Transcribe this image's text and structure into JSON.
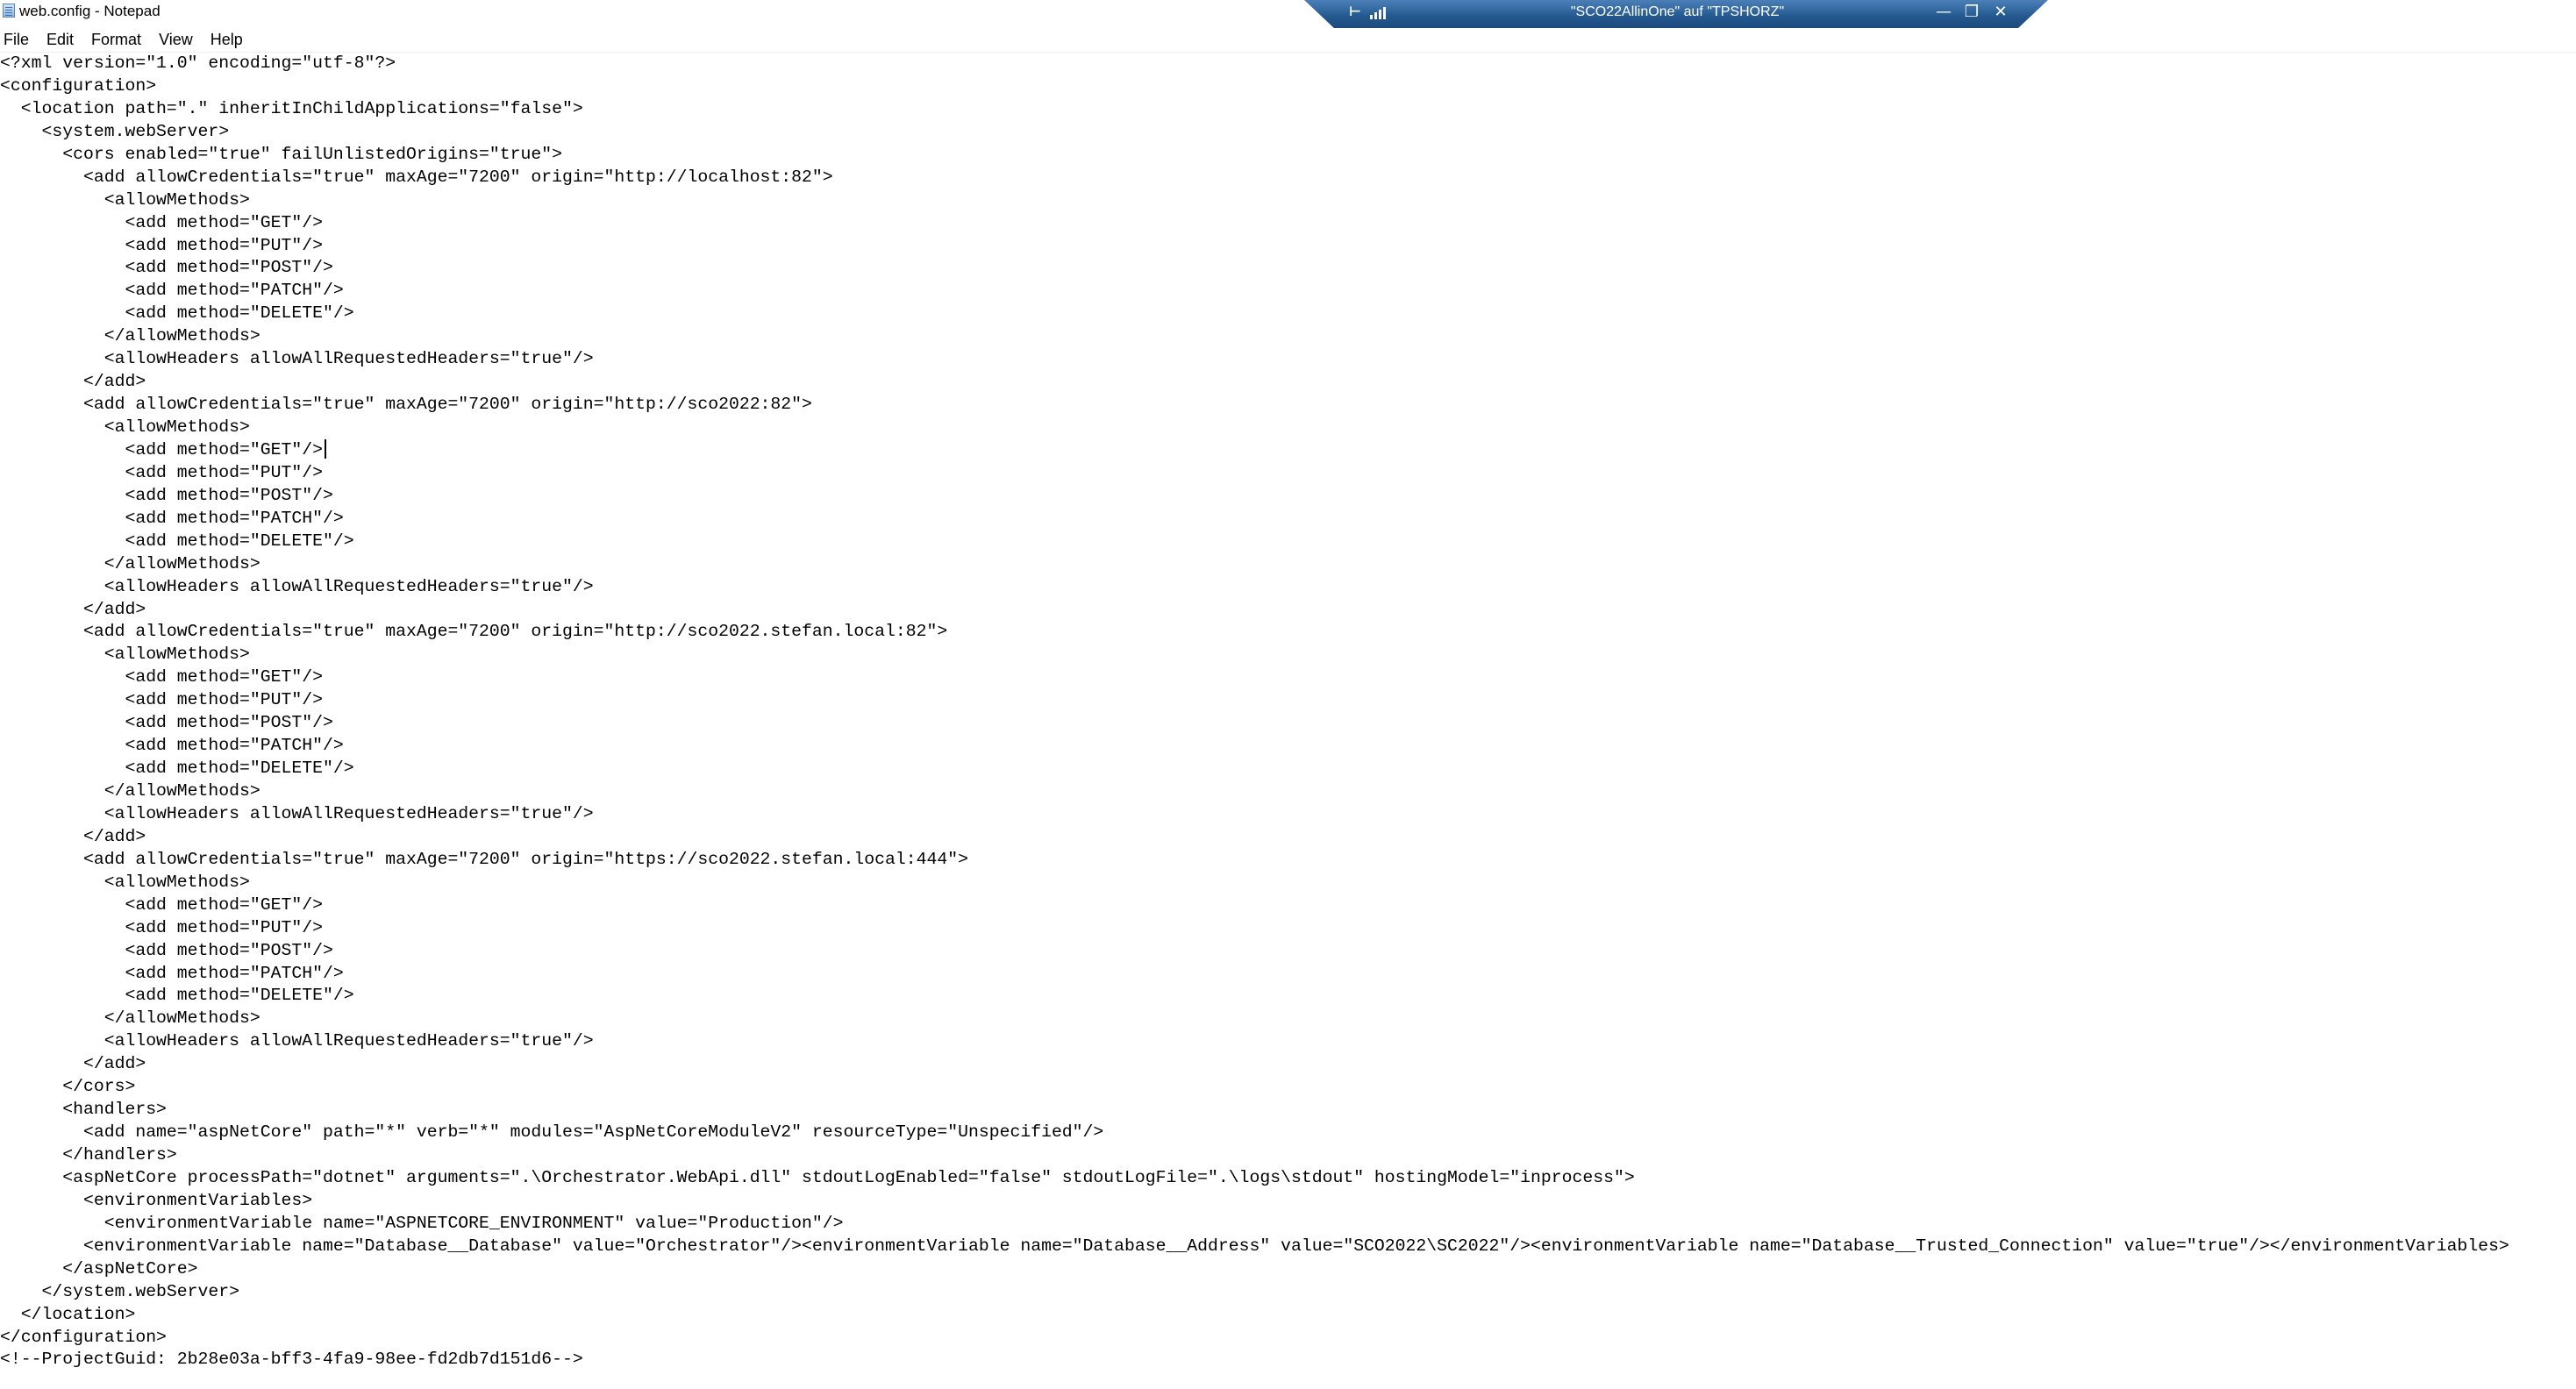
{
  "window": {
    "title": "web.config - Notepad"
  },
  "remote_bar": {
    "title": "\"SCO22AllinOne\" auf \"TPSHORZ\"",
    "minimize": "—",
    "restore": "❐",
    "close": "✕"
  },
  "menu": {
    "items": [
      {
        "label": "File"
      },
      {
        "label": "Edit"
      },
      {
        "label": "Format"
      },
      {
        "label": "View"
      },
      {
        "label": "Help"
      }
    ]
  },
  "editor": {
    "lines": [
      "<?xml version=\"1.0\" encoding=\"utf-8\"?>",
      "<configuration>",
      "  <location path=\".\" inheritInChildApplications=\"false\">",
      "    <system.webServer>",
      "      <cors enabled=\"true\" failUnlistedOrigins=\"true\">",
      "        <add allowCredentials=\"true\" maxAge=\"7200\" origin=\"http://localhost:82\">",
      "          <allowMethods>",
      "            <add method=\"GET\"/>",
      "            <add method=\"PUT\"/>",
      "            <add method=\"POST\"/>",
      "            <add method=\"PATCH\"/>",
      "            <add method=\"DELETE\"/>",
      "          </allowMethods>",
      "          <allowHeaders allowAllRequestedHeaders=\"true\"/>",
      "        </add>",
      "        <add allowCredentials=\"true\" maxAge=\"7200\" origin=\"http://sco2022:82\">",
      "          <allowMethods>",
      "            <add method=\"GET\"/>",
      "            <add method=\"PUT\"/>",
      "            <add method=\"POST\"/>",
      "            <add method=\"PATCH\"/>",
      "            <add method=\"DELETE\"/>",
      "          </allowMethods>",
      "          <allowHeaders allowAllRequestedHeaders=\"true\"/>",
      "        </add>",
      "        <add allowCredentials=\"true\" maxAge=\"7200\" origin=\"http://sco2022.stefan.local:82\">",
      "          <allowMethods>",
      "            <add method=\"GET\"/>",
      "            <add method=\"PUT\"/>",
      "            <add method=\"POST\"/>",
      "            <add method=\"PATCH\"/>",
      "            <add method=\"DELETE\"/>",
      "          </allowMethods>",
      "          <allowHeaders allowAllRequestedHeaders=\"true\"/>",
      "        </add>",
      "        <add allowCredentials=\"true\" maxAge=\"7200\" origin=\"https://sco2022.stefan.local:444\">",
      "          <allowMethods>",
      "            <add method=\"GET\"/>",
      "            <add method=\"PUT\"/>",
      "            <add method=\"POST\"/>",
      "            <add method=\"PATCH\"/>",
      "            <add method=\"DELETE\"/>",
      "          </allowMethods>",
      "          <allowHeaders allowAllRequestedHeaders=\"true\"/>",
      "        </add>",
      "      </cors>",
      "      <handlers>",
      "        <add name=\"aspNetCore\" path=\"*\" verb=\"*\" modules=\"AspNetCoreModuleV2\" resourceType=\"Unspecified\"/>",
      "      </handlers>",
      "      <aspNetCore processPath=\"dotnet\" arguments=\".\\Orchestrator.WebApi.dll\" stdoutLogEnabled=\"false\" stdoutLogFile=\".\\logs\\stdout\" hostingModel=\"inprocess\">",
      "        <environmentVariables>",
      "          <environmentVariable name=\"ASPNETCORE_ENVIRONMENT\" value=\"Production\"/>",
      "        <environmentVariable name=\"Database__Database\" value=\"Orchestrator\"/><environmentVariable name=\"Database__Address\" value=\"SCO2022\\SC2022\"/><environmentVariable name=\"Database__Trusted_Connection\" value=\"true\"/></environmentVariables>",
      "      </aspNetCore>",
      "    </system.webServer>",
      "  </location>",
      "</configuration>",
      "<!--ProjectGuid: 2b28e03a-bff3-4fa9-98ee-fd2db7d151d6-->"
    ]
  }
}
